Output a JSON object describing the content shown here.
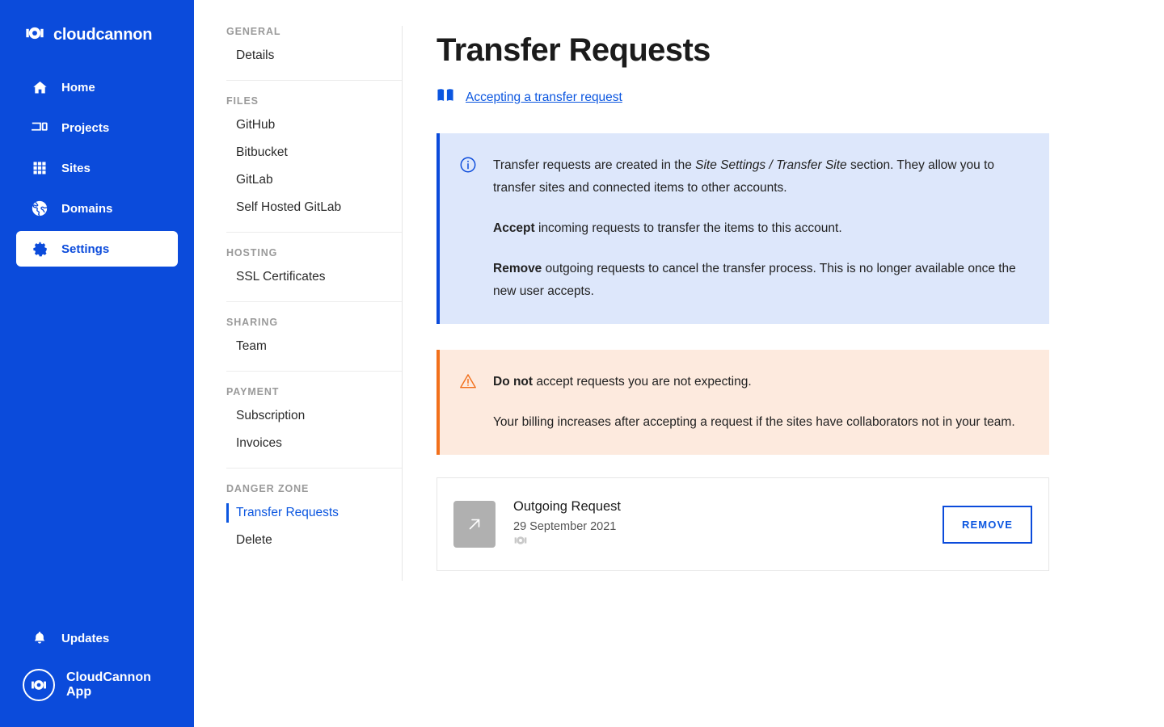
{
  "brand": {
    "name": "cloudcannon",
    "logo_icon": "cloudcannon-mark-icon"
  },
  "sidebar": {
    "items": [
      {
        "label": "Home",
        "icon": "home-icon",
        "active": false
      },
      {
        "label": "Projects",
        "icon": "projects-icon",
        "active": false
      },
      {
        "label": "Sites",
        "icon": "grid-icon",
        "active": false
      },
      {
        "label": "Domains",
        "icon": "globe-icon",
        "active": false
      },
      {
        "label": "Settings",
        "icon": "gear-icon",
        "active": true
      }
    ],
    "updates_label": "Updates",
    "updates_icon": "bell-icon",
    "app_label": "CloudCannon App",
    "app_icon": "cloudcannon-circle-icon"
  },
  "subnav": {
    "groups": [
      {
        "title": "GENERAL",
        "items": [
          {
            "label": "Details",
            "active": false
          }
        ]
      },
      {
        "title": "FILES",
        "items": [
          {
            "label": "GitHub",
            "active": false
          },
          {
            "label": "Bitbucket",
            "active": false
          },
          {
            "label": "GitLab",
            "active": false
          },
          {
            "label": "Self Hosted GitLab",
            "active": false
          }
        ]
      },
      {
        "title": "HOSTING",
        "items": [
          {
            "label": "SSL Certificates",
            "active": false
          }
        ]
      },
      {
        "title": "SHARING",
        "items": [
          {
            "label": "Team",
            "active": false
          }
        ]
      },
      {
        "title": "PAYMENT",
        "items": [
          {
            "label": "Subscription",
            "active": false
          },
          {
            "label": "Invoices",
            "active": false
          }
        ]
      },
      {
        "title": "DANGER ZONE",
        "items": [
          {
            "label": "Transfer Requests",
            "active": true
          },
          {
            "label": "Delete",
            "active": false
          }
        ]
      }
    ]
  },
  "main": {
    "title": "Transfer Requests",
    "doc_link": {
      "label": "Accepting a transfer request",
      "icon": "book-icon"
    },
    "info_callout": {
      "icon": "info-circle-icon",
      "p1_a": "Transfer requests are created in the ",
      "p1_em": "Site Settings / Transfer Site",
      "p1_b": " section. They allow you to transfer sites and connected items to other accounts.",
      "p2_strong": "Accept",
      "p2_rest": " incoming requests to transfer the items to this account.",
      "p3_strong": "Remove",
      "p3_rest": " outgoing requests to cancel the transfer process. This is no longer available once the new user accepts."
    },
    "warning_callout": {
      "icon": "warning-triangle-icon",
      "p1_strong": "Do not",
      "p1_rest": " accept requests you are not expecting.",
      "p2": "Your billing increases after accepting a request if the sites have collaborators not in your team."
    },
    "requests": [
      {
        "thumb_icon": "arrow-up-right-icon",
        "title": "Outgoing Request",
        "date": "29 September 2021",
        "site_logo_icon": "cloudcannon-mark-icon",
        "action_label": "REMOVE"
      }
    ]
  },
  "colors": {
    "brand_blue": "#0B4BDB",
    "link_blue": "#0B56E0",
    "info_bg": "#dde7fb",
    "warning_bg": "#fdeade",
    "warning_accent": "#F2701C"
  }
}
